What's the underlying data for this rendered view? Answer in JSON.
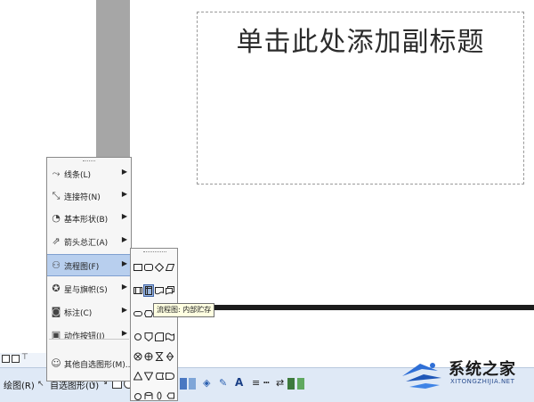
{
  "slide": {
    "subtitle_placeholder": "单击此处添加副标题"
  },
  "menu": {
    "items": [
      {
        "icon": "lines-icon",
        "label": "线条(L)",
        "has_submenu": true
      },
      {
        "icon": "connector-icon",
        "label": "连接符(N)",
        "has_submenu": true
      },
      {
        "icon": "basic-shapes-icon",
        "label": "基本形状(B)",
        "has_submenu": true
      },
      {
        "icon": "block-arrows-icon",
        "label": "箭头总汇(A)",
        "has_submenu": true
      },
      {
        "icon": "flowchart-icon",
        "label": "流程图(F)",
        "has_submenu": true,
        "highlighted": true
      },
      {
        "icon": "stars-banners-icon",
        "label": "星与旗帜(S)",
        "has_submenu": true
      },
      {
        "icon": "callouts-icon",
        "label": "标注(C)",
        "has_submenu": true
      },
      {
        "icon": "action-buttons-icon",
        "label": "动作按钮(I)",
        "has_submenu": true
      },
      {
        "icon": "more-autoshapes-icon",
        "label": "其他自选图形(M)...",
        "has_submenu": false
      }
    ]
  },
  "tooltip": {
    "text": "流程图: 内部贮存"
  },
  "toolbar": {
    "draw_label": "绘图(R)",
    "autoshapes_label": "自选图形(U)"
  },
  "logo": {
    "name": "系统之家",
    "url_text": "XITONGZHIJIA.NET",
    "accent": "#2f6fd6"
  }
}
